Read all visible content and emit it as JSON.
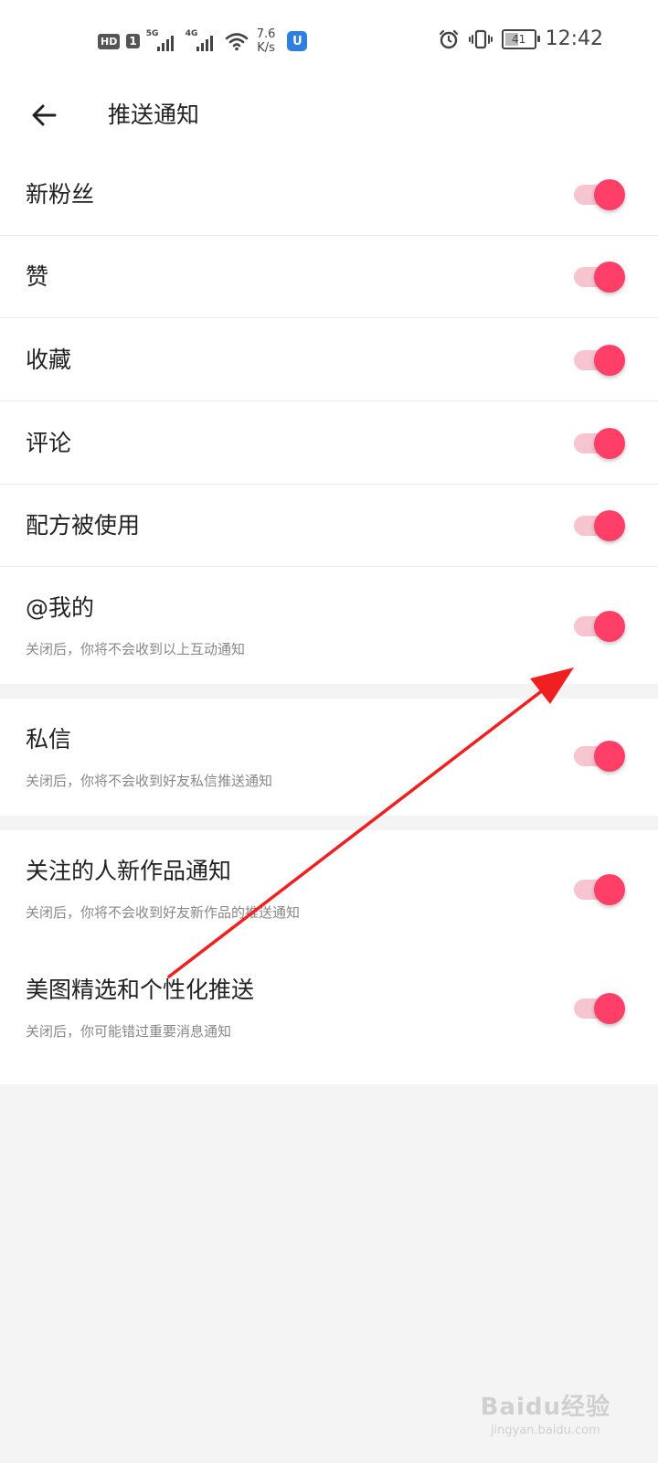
{
  "status_bar": {
    "hd": "HD",
    "sim": "1",
    "net1": "5G",
    "net2": "4G",
    "speed_value": "7.6",
    "speed_unit": "K/s",
    "app_icon": "U",
    "battery": "41",
    "time": "12:42"
  },
  "header": {
    "title": "推送通知"
  },
  "rows": [
    {
      "label": "新粉丝"
    },
    {
      "label": "赞"
    },
    {
      "label": "收藏"
    },
    {
      "label": "评论"
    },
    {
      "label": "配方被使用"
    },
    {
      "label": "@我的",
      "sub": "关闭后，你将不会收到以上互动通知"
    },
    {
      "label": "私信",
      "sub": "关闭后，你将不会收到好友私信推送通知"
    },
    {
      "label": "关注的人新作品通知",
      "sub": "关闭后，你将不会收到好友新作品的推送通知"
    },
    {
      "label": "美图精选和个性化推送",
      "sub": "关闭后，你可能错过重要消息通知"
    }
  ],
  "watermark": {
    "line1": "Baidu经验",
    "line2": "jingyan.baidu.com"
  },
  "colors": {
    "accent": "#ff3f68",
    "track": "#f7c5cf",
    "annotation": "#f02020"
  },
  "icons": [
    "back-arrow-icon",
    "wifi-icon",
    "alarm-icon",
    "vibrate-icon",
    "battery-icon"
  ]
}
